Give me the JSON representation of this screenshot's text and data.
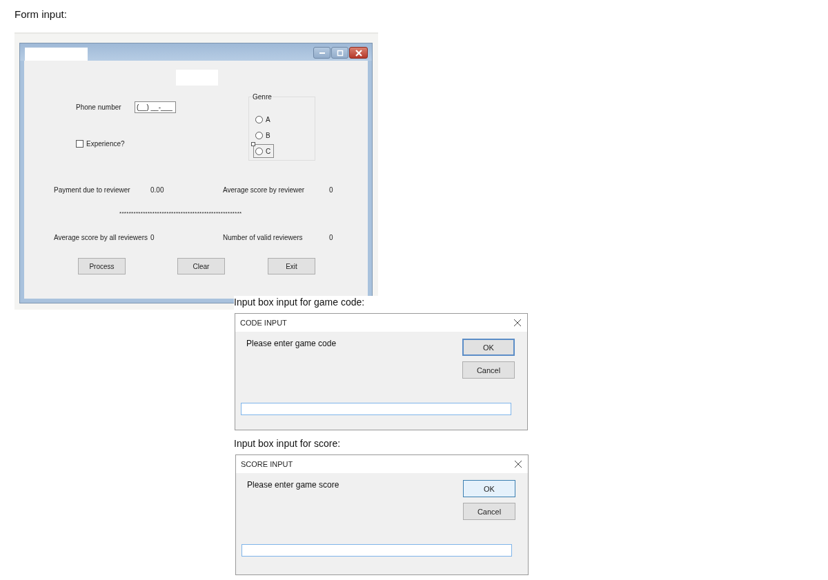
{
  "heading": "Form input:",
  "phone": {
    "label": "Phone number",
    "value": "(__) __-___"
  },
  "experience": {
    "label": "Experience?",
    "checked": false
  },
  "genre": {
    "title": "Genre",
    "options": [
      {
        "label": "A",
        "selected": false,
        "focused": false
      },
      {
        "label": "B",
        "selected": false,
        "focused": false
      },
      {
        "label": "C",
        "selected": false,
        "focused": true
      }
    ]
  },
  "results": [
    {
      "label": "Payment due to reviewer",
      "value": "0.00"
    },
    {
      "label": "Average score by reviewer",
      "value": "0"
    },
    {
      "label": "Average score by all reviewers",
      "value": "0"
    },
    {
      "label": "Number of valid reviewers",
      "value": "0"
    }
  ],
  "separator": "****************************************************",
  "buttons": [
    "Process",
    "Clear",
    "Exit"
  ],
  "dialogs": [
    {
      "caption": "Input box input for game code:",
      "title": "CODE INPUT",
      "prompt": "Please enter game code",
      "ok": {
        "label": "OK",
        "focused": false
      },
      "cancel": "Cancel"
    },
    {
      "caption": "Input box input for score:",
      "title": "SCORE INPUT",
      "prompt": "Please enter game score",
      "ok": {
        "label": "OK",
        "focused": true
      },
      "cancel": "Cancel"
    }
  ]
}
